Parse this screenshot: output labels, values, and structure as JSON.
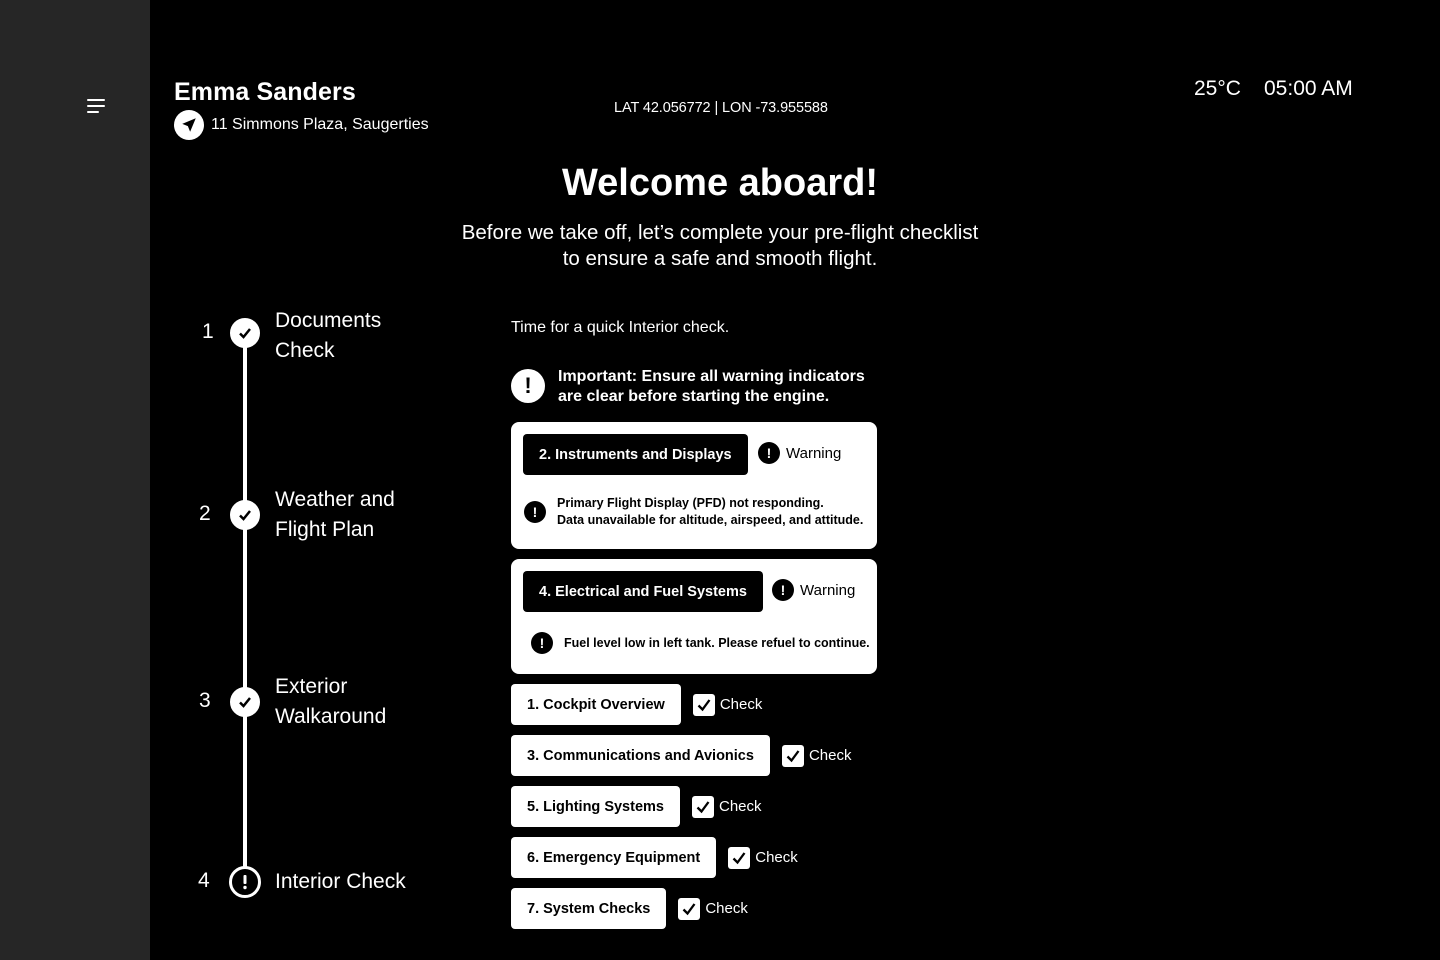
{
  "user": {
    "name": "Emma Sanders",
    "address": "11 Simmons Plaza, Saugerties"
  },
  "coords": "LAT 42.056772 | LON -73.955588",
  "weather": {
    "temperature": "25°C"
  },
  "clock": {
    "time": "05:00 AM"
  },
  "welcome": {
    "title": "Welcome aboard!",
    "subtitle_line1": "Before we take off, let’s complete your pre-flight checklist",
    "subtitle_line2": "to ensure a safe and smooth flight."
  },
  "steps": [
    {
      "number": "1",
      "line1": "Documents",
      "line2": "Check",
      "status": "complete"
    },
    {
      "number": "2",
      "line1": "Weather and",
      "line2": "Flight Plan",
      "status": "complete"
    },
    {
      "number": "3",
      "line1": "Exterior",
      "line2": "Walkaround",
      "status": "complete"
    },
    {
      "number": "4",
      "line1": "Interior Check",
      "line2": "",
      "status": "warning"
    }
  ],
  "content": {
    "intro": "Time for a quick Interior check.",
    "important_line1": "Important: Ensure all warning indicators",
    "important_line2": "are clear before starting the engine."
  },
  "warnings": [
    {
      "title": "2. Instruments and Displays",
      "badge": "Warning",
      "message_line1": "Primary Flight Display (PFD) not responding.",
      "message_line2": "Data unavailable for altitude, airspeed, and attitude."
    },
    {
      "title": "4. Electrical and Fuel Systems",
      "badge": "Warning",
      "message_line1": "Fuel level low in left tank. Please refuel to continue.",
      "message_line2": ""
    }
  ],
  "checks": [
    {
      "title": "1. Cockpit Overview",
      "label": "Check",
      "checked": true
    },
    {
      "title": "3. Communications and Avionics",
      "label": "Check",
      "checked": true
    },
    {
      "title": "5. Lighting Systems",
      "label": "Check",
      "checked": true
    },
    {
      "title": "6. Emergency Equipment",
      "label": "Check",
      "checked": true
    },
    {
      "title": "7. System Checks",
      "label": "Check",
      "checked": true
    }
  ]
}
